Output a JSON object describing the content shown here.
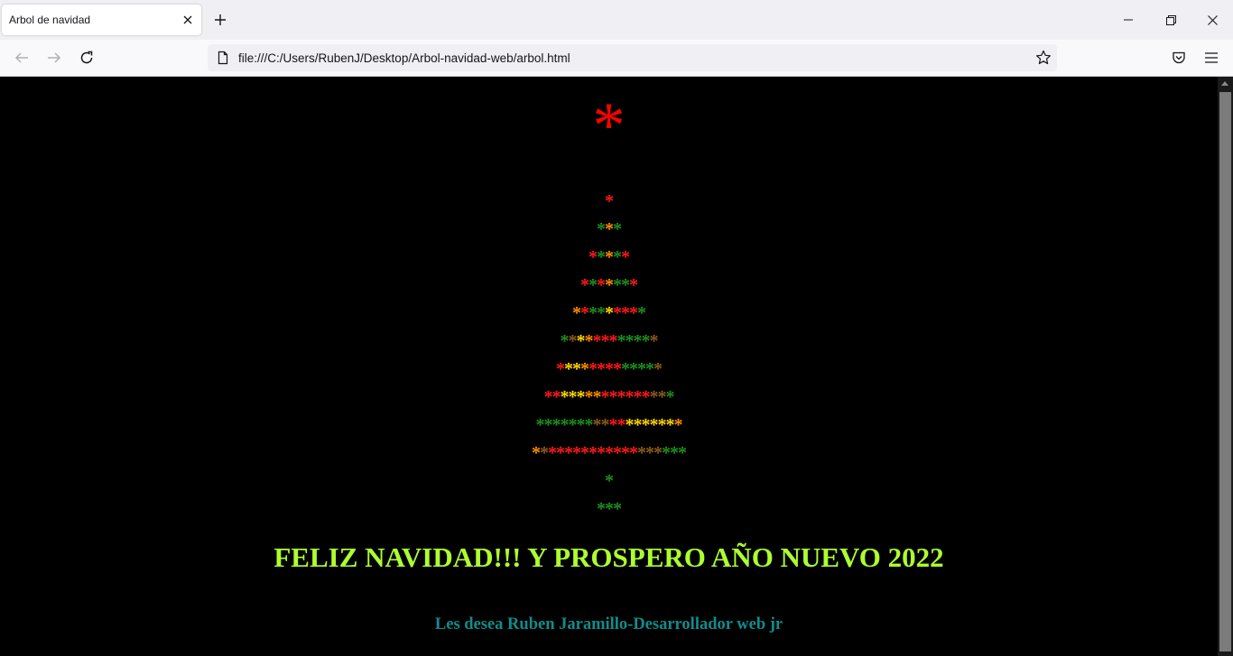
{
  "browser": {
    "tab_title": "Arbol de navidad",
    "url": "file:///C:/Users/RubenJ/Desktop/Arbol-navidad-web/arbol.html"
  },
  "page": {
    "top_star": "*",
    "tree_rows": [
      [
        "R"
      ],
      [
        "G",
        "O",
        "G"
      ],
      [
        "R",
        "G",
        "O",
        "G",
        "R"
      ],
      [
        "R",
        "G",
        "R",
        "O",
        "G",
        "G",
        "R"
      ],
      [
        "O",
        "R",
        "G",
        "G",
        "Y",
        "R",
        "R",
        "R",
        "G"
      ],
      [
        "G",
        "D",
        "Y",
        "O",
        "R",
        "R",
        "R",
        "G",
        "G",
        "G",
        "G",
        "D"
      ],
      [
        "R",
        "Y",
        "Y",
        "O",
        "R",
        "R",
        "R",
        "R",
        "G",
        "G",
        "G",
        "G",
        "D"
      ],
      [
        "R",
        "R",
        "Y",
        "Y",
        "Y",
        "O",
        "O",
        "R",
        "R",
        "R",
        "R",
        "R",
        "R",
        "D",
        "D",
        "G"
      ],
      [
        "G",
        "G",
        "G",
        "G",
        "G",
        "G",
        "G",
        "D",
        "D",
        "R",
        "R",
        "Y",
        "Y",
        "Y",
        "Y",
        "Y",
        "Y",
        "O"
      ],
      [
        "O",
        "D",
        "R",
        "R",
        "R",
        "R",
        "R",
        "R",
        "R",
        "R",
        "R",
        "R",
        "R",
        "D",
        "D",
        "D",
        "G",
        "G",
        "G"
      ],
      [
        "G"
      ],
      [
        "G",
        "G",
        "G"
      ]
    ],
    "tree_colors": {
      "R": "#ff1a1a",
      "G": "#1f8f1f",
      "O": "#ff8c00",
      "Y": "#ffd700",
      "D": "#8b5a1a"
    },
    "heading": "FELIZ NAVIDAD!!! Y PROSPERO AÑO NUEVO 2022",
    "signature": "Les desea Ruben Jaramillo-Desarrollador web jr"
  }
}
